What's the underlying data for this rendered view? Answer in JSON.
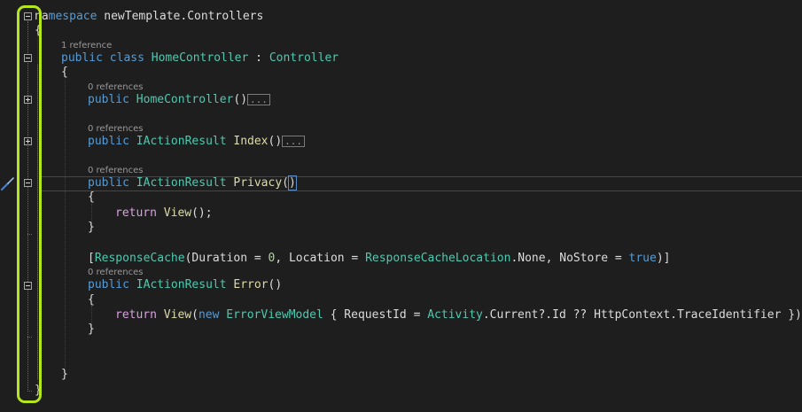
{
  "code": {
    "line1": {
      "prefix": "na",
      "kw": "mespace",
      "name": "newTemplate.Controllers"
    },
    "brace_open": "{",
    "brace_close": "}",
    "lens_class": "1 reference",
    "class_line": {
      "kw1": "public",
      "kw2": "class",
      "name": "HomeController",
      "sep": " : ",
      "base": "Controller"
    },
    "lens_ctor": "0 references",
    "ctor_line": {
      "kw": "public",
      "name": "HomeController",
      "parens": "()",
      "collapsed": "..."
    },
    "lens_index": "0 references",
    "index_line": {
      "kw": "public",
      "type": "IActionResult",
      "name": "Index",
      "parens": "()",
      "collapsed": "..."
    },
    "lens_privacy": "0 references",
    "privacy_line": {
      "kw": "public",
      "type": "IActionResult",
      "name": "Privacy",
      "paren_open": "(",
      "paren_close": ")"
    },
    "return_kw": "return",
    "view": "View",
    "privacy_return_tail": "();",
    "attr_line": {
      "open": "[",
      "attr": "ResponseCache",
      "p1": "(Duration = ",
      "num": "0",
      "p2": ", Location = ",
      "enum_type": "ResponseCacheLocation",
      "p3": ".None, NoStore = ",
      "bool": "true",
      "close": ")]"
    },
    "lens_error": "0 references",
    "error_line": {
      "kw": "public",
      "type": "IActionResult",
      "name": "Error",
      "parens": "()"
    },
    "error_return": {
      "kw": "return",
      "view": "View",
      "p1": "(",
      "new_kw": "new",
      "type": "ErrorViewModel",
      "p2": " { RequestId = ",
      "activity": "Activity",
      "p3": ".Current?.Id ?? HttpContext.TraceIdentifier });"
    }
  },
  "icons": {
    "refactor": "screwdriver-icon",
    "fold_expanded": "fold-minus-icon",
    "fold_collapsed": "fold-plus-icon"
  },
  "colors": {
    "background": "#1e1e1e",
    "keyword": "#569cd6",
    "control_keyword": "#d8a0df",
    "type": "#4ec9b0",
    "method": "#dcdcaa",
    "number": "#b5cea8",
    "highlight": "#b5e61d"
  }
}
